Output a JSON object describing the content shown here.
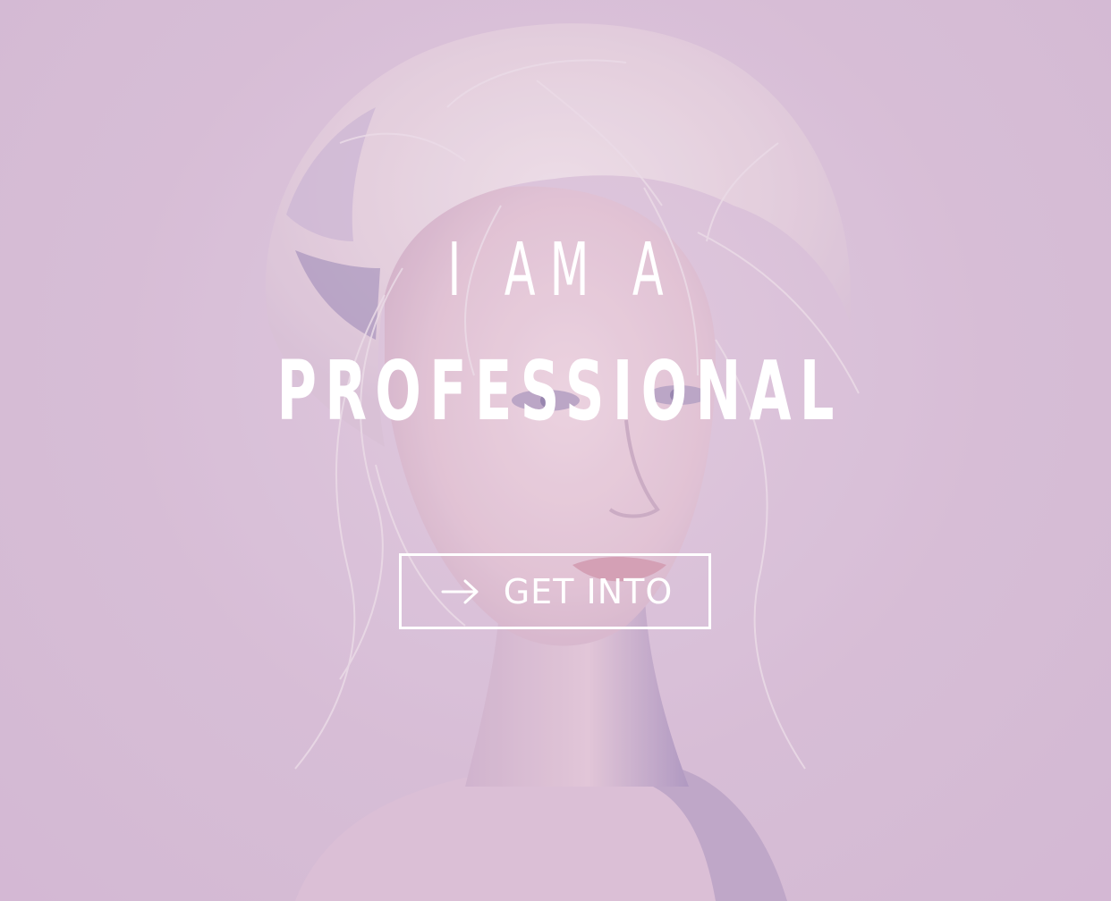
{
  "hero": {
    "headline_line1": "I AM A",
    "headline_line2": "PROFESSIONAL",
    "cta": {
      "label": "GET INTO",
      "icon": "arrow-right-icon"
    }
  },
  "colors": {
    "background": "#d8c0d8",
    "tint": "#d6bcd6",
    "text": "#ffffff",
    "hair": "#eadbe2",
    "skin": "#e9ccd6"
  }
}
